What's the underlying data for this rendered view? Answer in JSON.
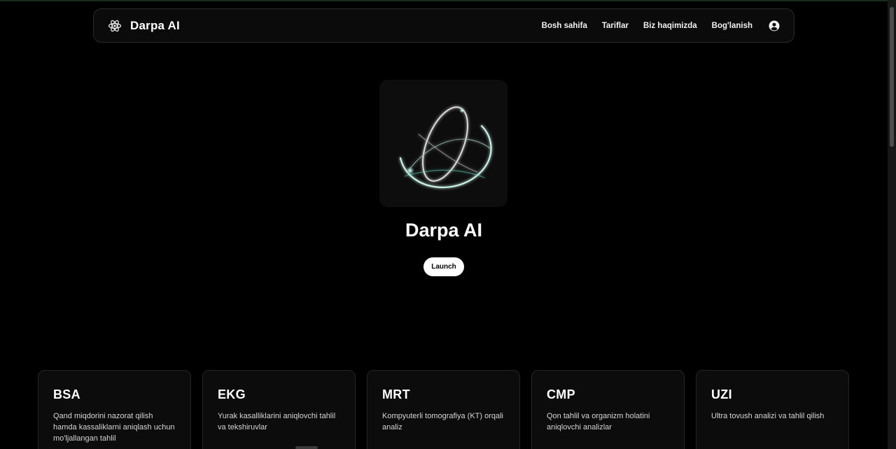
{
  "brand": {
    "name": "Darpa AI",
    "logo_icon": "atom-icon"
  },
  "nav": {
    "links": [
      "Bosh sahifa",
      "Tariflar",
      "Biz haqimizda",
      "Bog'lanish"
    ],
    "account_icon": "user-circle-icon"
  },
  "hero": {
    "title": "Darpa AI",
    "launch_label": "Launch",
    "image_icon": "atom-orbit-icon"
  },
  "cards": [
    {
      "title": "BSA",
      "description": "Qand miqdorini nazorat qilish hamda kassaliklarni aniqlash uchun mo'ljallangan tahlil"
    },
    {
      "title": "EKG",
      "description": "Yurak kasalliklarini aniqlovchi tahlil va tekshiruvlar"
    },
    {
      "title": "MRT",
      "description": "Kompyuterli tomografiya (KT) orqali analiz"
    },
    {
      "title": "CMP",
      "description": "Qon tahlil va organizm holatini aniqlovchi analizlar"
    },
    {
      "title": "UZI",
      "description": "Ultra tovush analizi va tahlil qilish"
    }
  ],
  "colors": {
    "background": "#000000",
    "card": "#0c0c0c",
    "accent_glow": "#6fe3c9"
  }
}
